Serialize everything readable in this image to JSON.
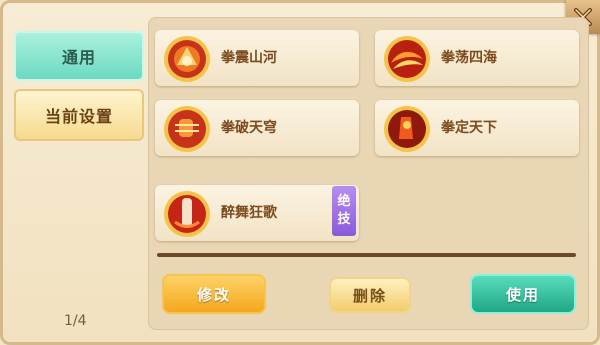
{
  "sidebar": {
    "tab_general": "通用",
    "tab_current": "当前设置",
    "page_indicator": "1/4"
  },
  "skills": [
    {
      "name": "拳震山河",
      "icon": "fist-earth-icon"
    },
    {
      "name": "拳荡四海",
      "icon": "fist-wave-icon"
    },
    {
      "name": "拳破天穹",
      "icon": "fist-sky-icon"
    },
    {
      "name": "拳定天下",
      "icon": "fist-world-icon"
    },
    {
      "name": "醉舞狂歌",
      "icon": "drunk-dance-icon",
      "badge": [
        "绝",
        "技"
      ]
    }
  ],
  "buttons": {
    "modify": "修改",
    "delete": "删除",
    "use": "使用"
  },
  "icons": {
    "close": "close-icon"
  }
}
